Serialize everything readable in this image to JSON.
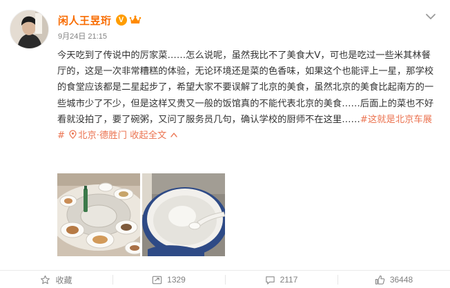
{
  "author": {
    "name": "闲人王昱珩",
    "verified_mark": "V",
    "time": "9月24日 21:15"
  },
  "post": {
    "text": "今天吃到了传说中的厉家菜……怎么说呢，虽然我比不了美食大V，可也是吃过一些米其林餐厅的，这是一次非常糟糕的体验，无论环境还是菜的色香味，如果这个也能评上一星，那学校的食堂应该都是二星起步了，希望大家不要误解了北京的美食，虽然北京的美食比起南方的一些城市少了不少，但是这样又贵又一般的饭馆真的不能代表北京的美食……后面上的菜也不好看就没拍了，要了碗粥，又问了服务员几句，确认学校的厨师不在这里……",
    "hashtag": "#这就是北京车展#",
    "location": "北京·德胜门",
    "collapse_label": "收起全文"
  },
  "actions": {
    "favorite_label": "收藏",
    "repost_count": "1329",
    "comment_count": "2117",
    "like_count": "36448"
  },
  "colors": {
    "author": "#f86b00",
    "link": "#eb7350",
    "text": "#333333",
    "meta": "#808080"
  },
  "icons": [
    "chevron-down-icon",
    "verified-v-icon",
    "member-crown-icon",
    "location-pin-icon",
    "star-icon",
    "repost-icon",
    "comment-icon",
    "like-icon"
  ]
}
